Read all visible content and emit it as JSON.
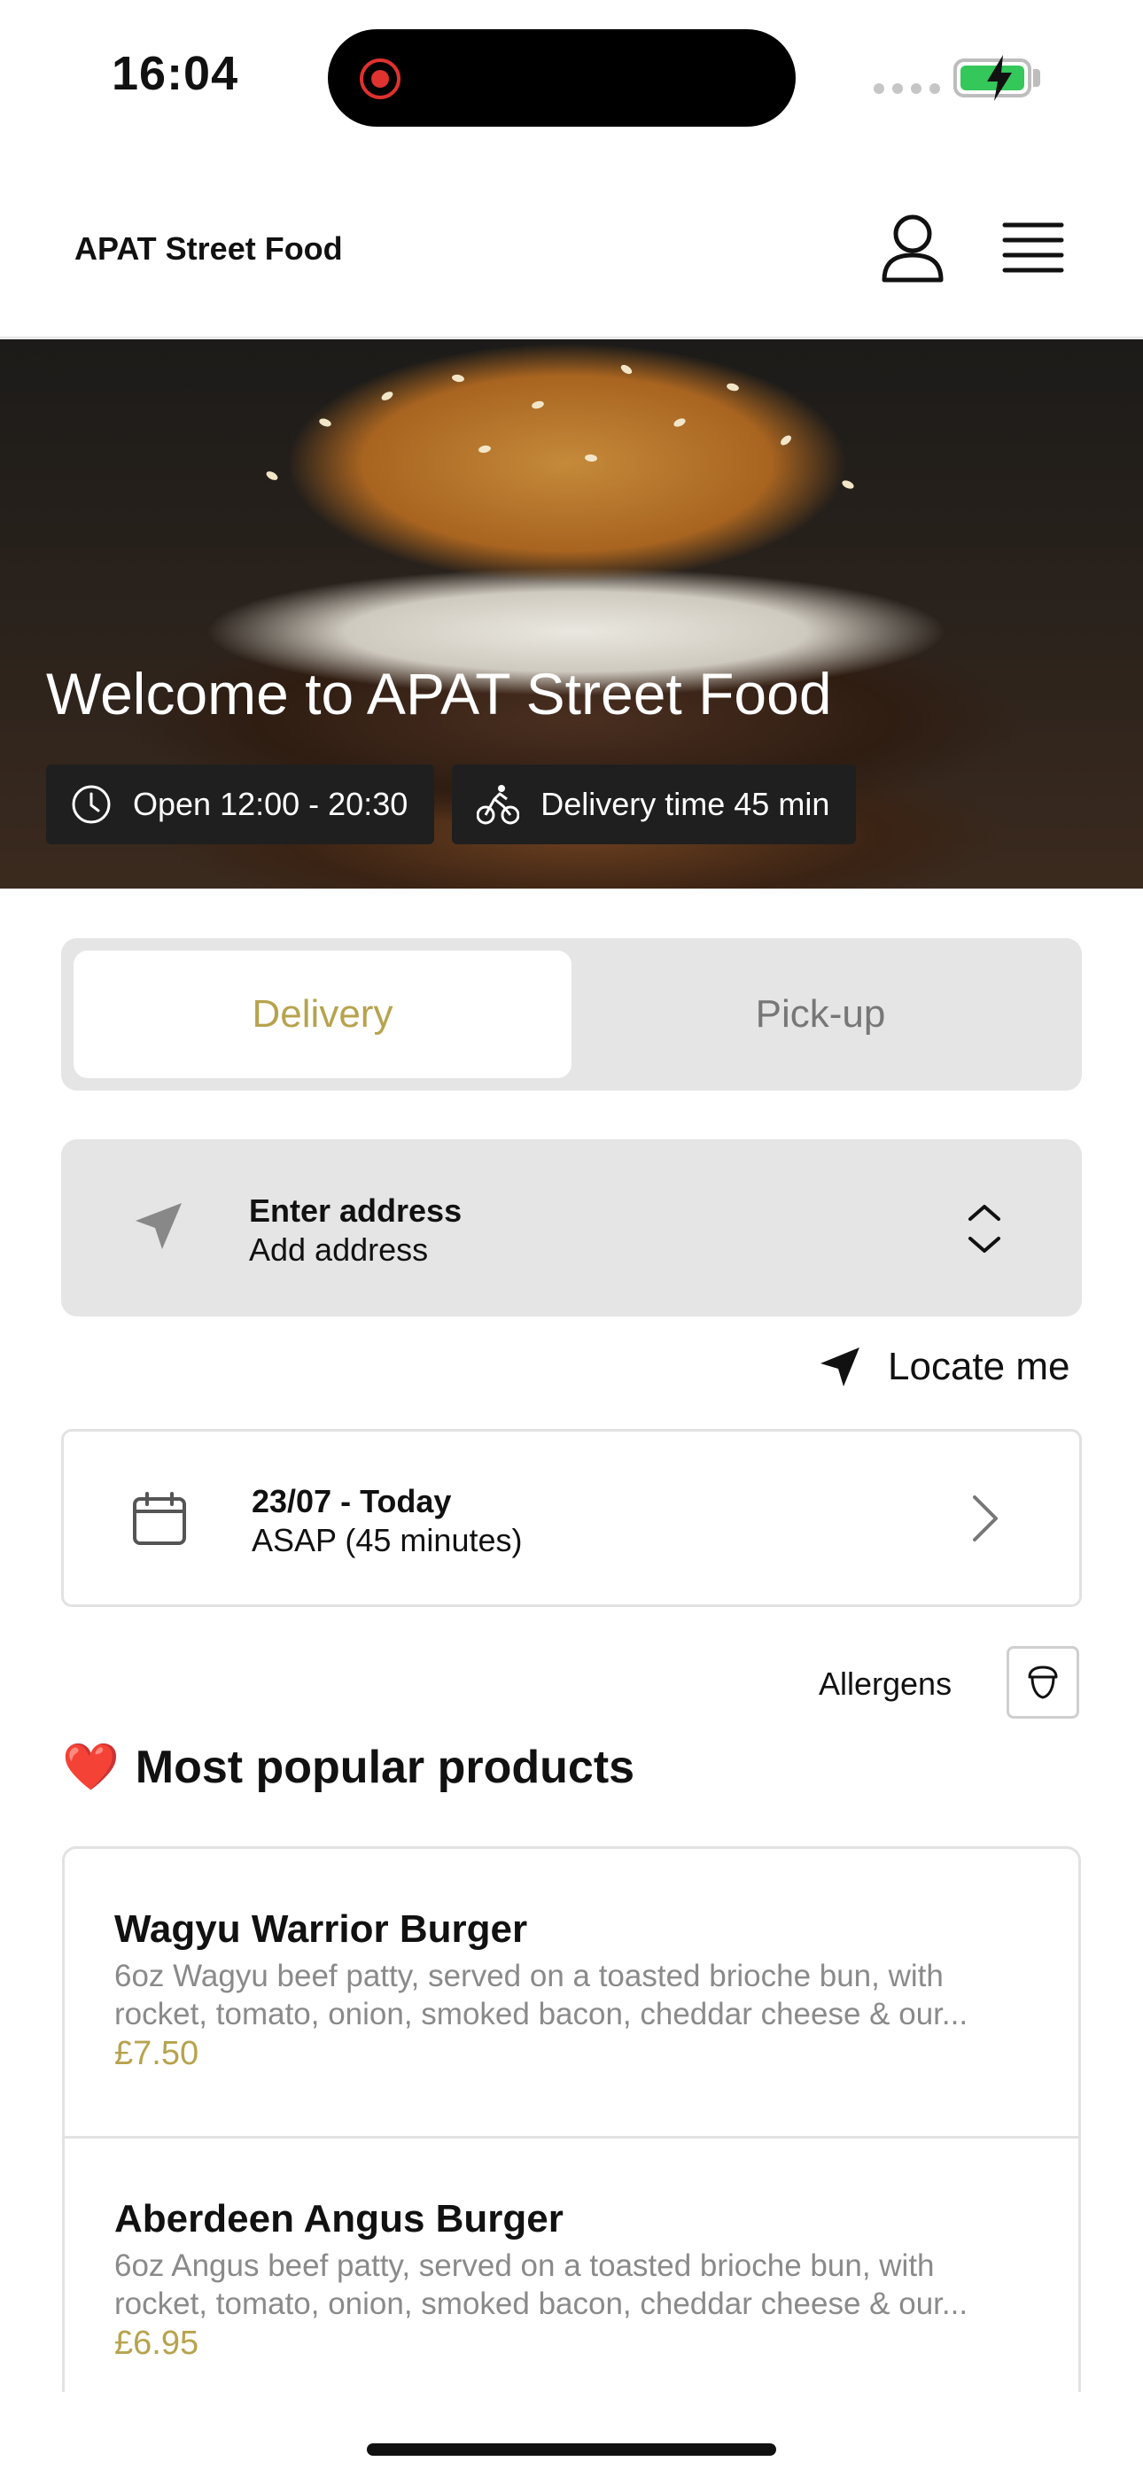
{
  "status_bar": {
    "time": "16:04"
  },
  "header": {
    "brand": "APAT Street Food"
  },
  "hero": {
    "title": "Welcome to APAT Street Food",
    "open_hours": "Open 12:00 - 20:30",
    "delivery_time": "Delivery time 45 min"
  },
  "mode_toggle": {
    "delivery": "Delivery",
    "pickup": "Pick-up",
    "selected": "Delivery"
  },
  "address": {
    "title": "Enter address",
    "subtitle": "Add address"
  },
  "locate": {
    "label": "Locate me"
  },
  "schedule": {
    "date": "23/07 - Today",
    "time": "ASAP (45 minutes)"
  },
  "allergens": {
    "label": "Allergens"
  },
  "popular": {
    "emoji": "❤️",
    "title": "Most popular products",
    "items": [
      {
        "name": "Wagyu Warrior Burger",
        "desc_line1": "6oz Wagyu beef patty, served on a toasted brioche bun, with",
        "desc_line2": "rocket, tomato, onion, smoked bacon, cheddar cheese & our...",
        "price": "£7.50"
      },
      {
        "name": "Aberdeen Angus Burger",
        "desc_line1": "6oz Angus beef patty, served on a toasted brioche bun, with",
        "desc_line2": "rocket, tomato, onion, smoked bacon, cheddar cheese & our...",
        "price": "£6.95"
      }
    ]
  },
  "colors": {
    "accent": "#b7a34e",
    "panel": "#e5e5e5",
    "badge_bg": "#1f1f1f",
    "battery": "#34c759",
    "recording": "#e0322f"
  }
}
